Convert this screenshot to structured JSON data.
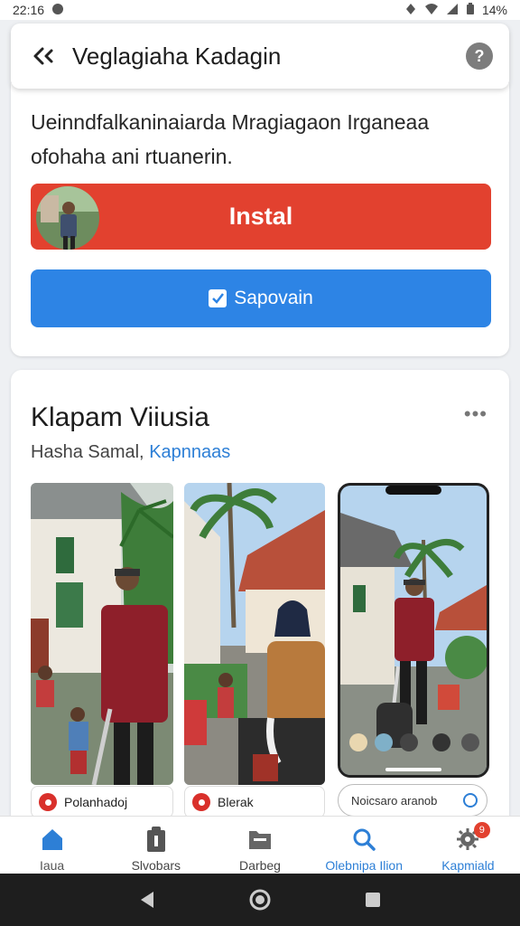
{
  "status_bar": {
    "time": "22:16",
    "battery": "14%"
  },
  "header": {
    "title": "Veglagiaha Kadagin"
  },
  "install_card": {
    "description": "Ueinndfalkaninaiarda Mragiagaon Irganeaa ofohaha ani rtuanerin.",
    "install_label": "Instal",
    "save_label": "Sapovain"
  },
  "gallery": {
    "title": "Klapam Viiusia",
    "subtitle_plain": "Hasha Samal,",
    "subtitle_link": "Kapnnaas",
    "cards": [
      {
        "label": "Polanhadoj"
      },
      {
        "label": "Blerak"
      }
    ],
    "search_pill": "Noicsaro aranob"
  },
  "bottom_nav": {
    "items": [
      {
        "label": "Iaua",
        "icon": "home-icon"
      },
      {
        "label": "Slvobars",
        "icon": "clipboard-icon"
      },
      {
        "label": "Darbeg",
        "icon": "folder-icon"
      },
      {
        "label": "Olebnipa Ilion",
        "icon": "search-icon"
      },
      {
        "label": "Kapmiald",
        "icon": "gear-icon",
        "badge": "9"
      }
    ]
  },
  "colors": {
    "install": "#e2412f",
    "save": "#2d84e5",
    "link": "#2d7fd6"
  }
}
